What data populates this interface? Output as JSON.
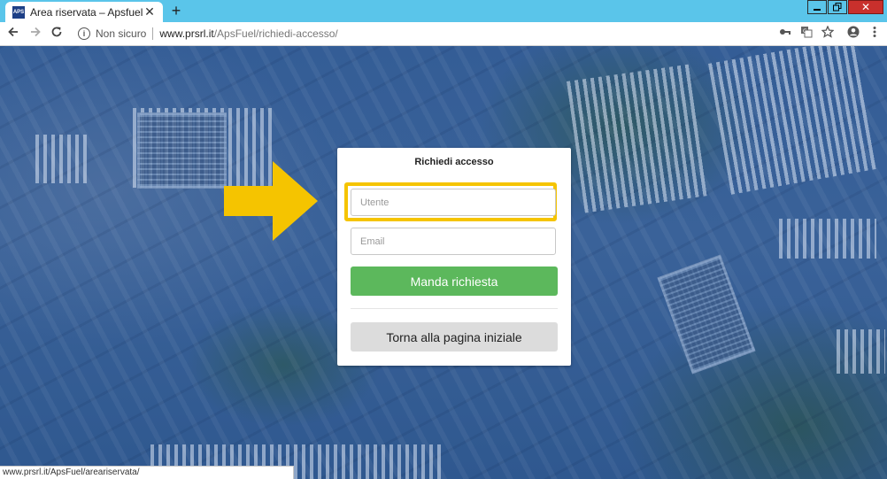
{
  "browser": {
    "tab_title": "Area riservata – Apsfuel",
    "favicon_text": "APS",
    "new_tab_symbol": "+",
    "security_label": "Non sicuro",
    "url_host": "www.prsrl.it",
    "url_path": "/ApsFuel/richiedi-accesso/",
    "status_url": "www.prsrl.it/ApsFuel/areariservata/",
    "tab_bg": "#5ac5ea"
  },
  "card": {
    "title": "Richiedi accesso",
    "username_placeholder": "Utente",
    "email_placeholder": "Email",
    "submit_label": "Manda richiesta",
    "back_label": "Torna alla pagina iniziale"
  },
  "colors": {
    "highlight": "#f5c400",
    "arrow": "#f5c400",
    "primary_button": "#5cb85c",
    "secondary_button": "#dcdcdc",
    "background_overlay": "#2f5690"
  },
  "icons": {
    "back": "arrow-left-icon",
    "forward": "arrow-right-icon",
    "reload": "reload-icon",
    "info": "info-icon",
    "key": "key-icon",
    "translate": "translate-icon",
    "star": "star-icon",
    "profile": "profile-icon",
    "menu": "menu-icon"
  }
}
